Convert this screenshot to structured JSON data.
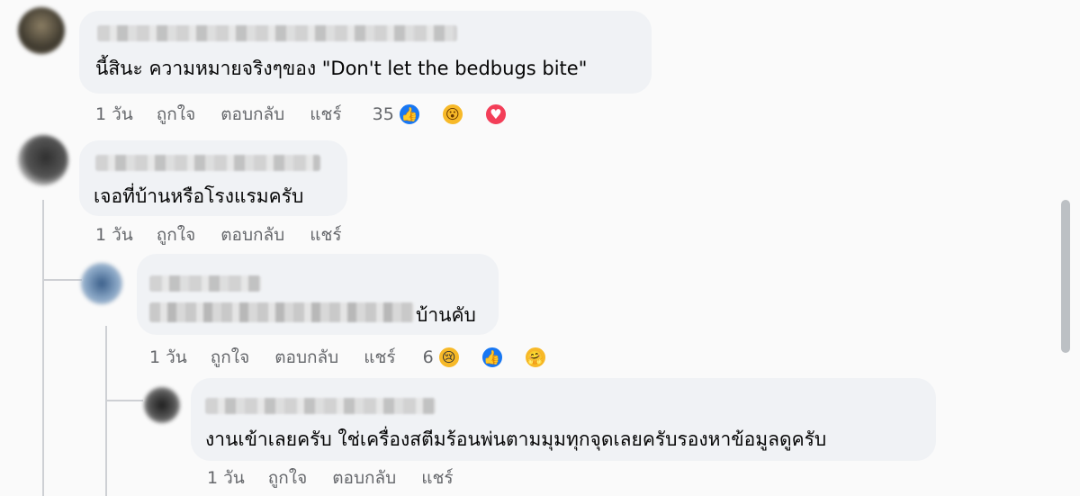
{
  "comments": [
    {
      "text": "นี้สินะ ความหมายจริงๆของ \"Don't let the bedbugs bite\"",
      "time": "1 วัน",
      "like": "ถูกใจ",
      "reply": "ตอบกลับ",
      "share": "แชร์",
      "reaction_count": "35",
      "reactions": [
        "like-icon",
        "wow-icon",
        "love-icon"
      ]
    },
    {
      "text": "เจอที่บ้านหรือโรงแรมครับ",
      "time": "1 วัน",
      "like": "ถูกใจ",
      "reply": "ตอบกลับ",
      "share": "แชร์"
    },
    {
      "text_suffix": "บ้านคับ",
      "time": "1 วัน",
      "like": "ถูกใจ",
      "reply": "ตอบกลับ",
      "share": "แชร์",
      "reaction_count": "6",
      "reactions": [
        "sad-icon",
        "like-icon",
        "care-icon"
      ]
    },
    {
      "text": "งานเข้าเลยครับ ใช่เครื่องสตีมร้อนพ่นตามมุมทุกจุดเลยครับรองหาข้อมูลดูครับ",
      "time": "1 วัน",
      "like": "ถูกใจ",
      "reply": "ตอบกลับ",
      "share": "แชร์"
    }
  ],
  "colors": {
    "bubble": "#f0f2f5",
    "action_text": "#65676b",
    "like": "#1877f2",
    "love": "#f33e58",
    "yellow": "#f7b928"
  }
}
